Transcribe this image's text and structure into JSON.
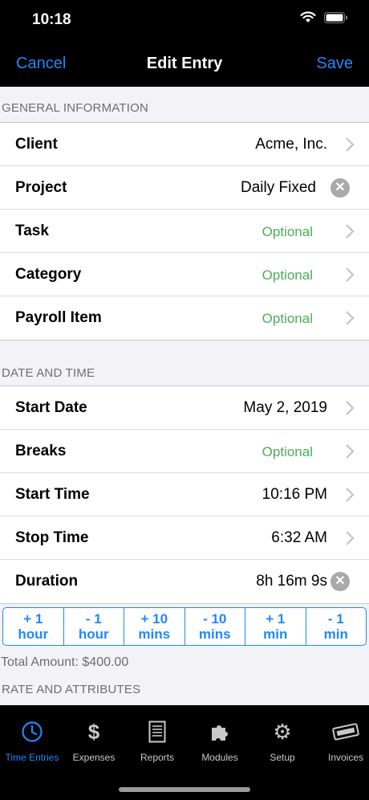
{
  "status_bar": {
    "time": "10:18"
  },
  "nav": {
    "cancel": "Cancel",
    "title": "Edit Entry",
    "save": "Save"
  },
  "general": {
    "header": "GENERAL INFORMATION",
    "rows": [
      {
        "label": "Client",
        "value": "Acme, Inc."
      },
      {
        "label": "Project",
        "value": "Daily Fixed"
      },
      {
        "label": "Task",
        "value": "Optional"
      },
      {
        "label": "Category",
        "value": "Optional"
      },
      {
        "label": "Payroll Item",
        "value": "Optional"
      }
    ]
  },
  "date_time": {
    "header": "DATE AND TIME",
    "rows": [
      {
        "label": "Start Date",
        "value": "May 2, 2019"
      },
      {
        "label": "Breaks",
        "value": "Optional"
      },
      {
        "label": "Start Time",
        "value": "10:16 PM"
      },
      {
        "label": "Stop Time",
        "value": "6:32 AM"
      },
      {
        "label": "Duration",
        "value": "8h 16m 9s"
      }
    ]
  },
  "adjust_buttons": [
    {
      "line1": "+ 1",
      "line2": "hour"
    },
    {
      "line1": "- 1",
      "line2": "hour"
    },
    {
      "line1": "+ 10",
      "line2": "mins"
    },
    {
      "line1": "- 10",
      "line2": "mins"
    },
    {
      "line1": "+ 1",
      "line2": "min"
    },
    {
      "line1": "- 1",
      "line2": "min"
    }
  ],
  "total_amount": "Total Amount: $400.00",
  "rate_header": "RATE AND ATTRIBUTES",
  "tabs": [
    {
      "label": "Time Entries",
      "icon": "clock-icon",
      "active": true
    },
    {
      "label": "Expenses",
      "icon": "dollar-icon"
    },
    {
      "label": "Reports",
      "icon": "document-icon"
    },
    {
      "label": "Modules",
      "icon": "puzzle-icon"
    },
    {
      "label": "Setup",
      "icon": "gear-icon"
    },
    {
      "label": "Invoices",
      "icon": "paid-stamp-icon"
    }
  ],
  "colors": {
    "accent": "#1f87ff",
    "optional": "#4cad5a",
    "background": "#f2f2f7"
  }
}
